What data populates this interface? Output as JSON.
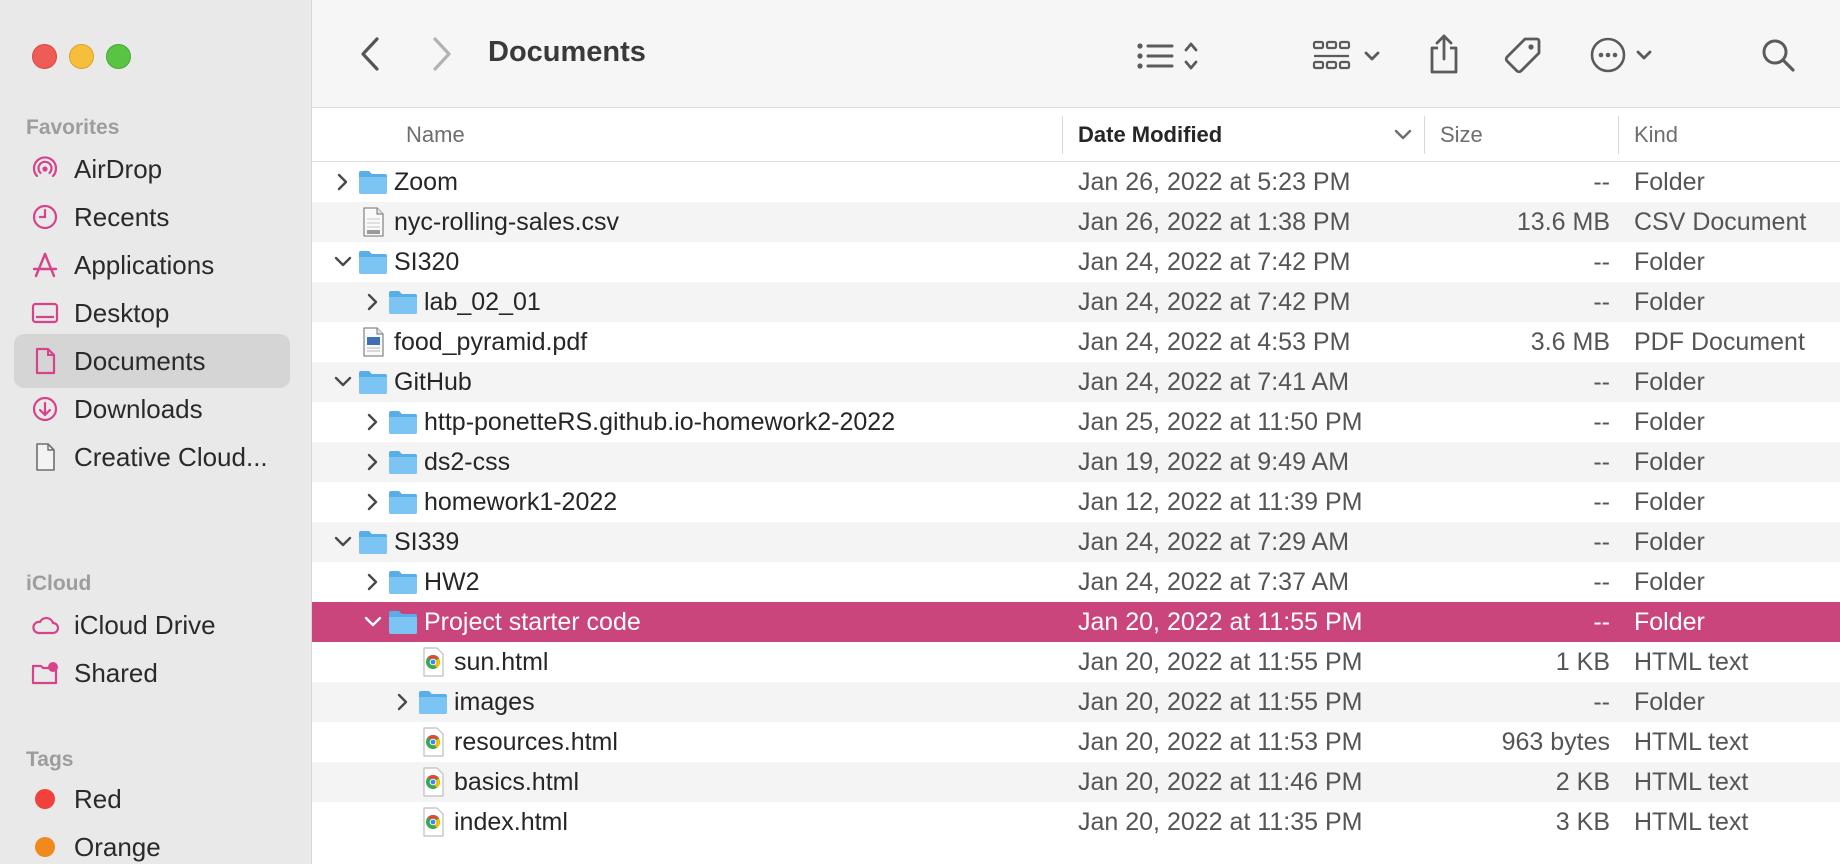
{
  "window": {
    "title": "Documents"
  },
  "colors": {
    "accent": "#c9457c",
    "folder": "#6cb9ee",
    "sidebar_icon": "#d6438a"
  },
  "sidebar": {
    "favorites_label": "Favorites",
    "favorites": [
      {
        "label": "AirDrop",
        "icon": "airdrop-icon"
      },
      {
        "label": "Recents",
        "icon": "clock-icon"
      },
      {
        "label": "Applications",
        "icon": "applications-icon"
      },
      {
        "label": "Desktop",
        "icon": "desktop-icon"
      },
      {
        "label": "Documents",
        "icon": "document-icon",
        "selected": true
      },
      {
        "label": "Downloads",
        "icon": "download-icon"
      },
      {
        "label": "Creative Cloud...",
        "icon": "file-icon"
      }
    ],
    "icloud_label": "iCloud",
    "icloud": [
      {
        "label": "iCloud Drive",
        "icon": "cloud-icon"
      },
      {
        "label": "Shared",
        "icon": "shared-folder-icon"
      }
    ],
    "tags_label": "Tags",
    "tags": [
      {
        "label": "Red",
        "color": "#f0423a"
      },
      {
        "label": "Orange",
        "color": "#f08a1c"
      }
    ]
  },
  "columns": {
    "name": "Name",
    "date": "Date Modified",
    "size": "Size",
    "kind": "Kind"
  },
  "files": [
    {
      "name": "Zoom",
      "date": "Jan 26, 2022 at 5:23 PM",
      "size": "--",
      "kind": "Folder",
      "type": "folder",
      "level": 0,
      "disclosure": "collapsed"
    },
    {
      "name": "nyc-rolling-sales.csv",
      "date": "Jan 26, 2022 at 1:38 PM",
      "size": "13.6 MB",
      "kind": "CSV Document",
      "type": "csv",
      "level": 0,
      "disclosure": "none"
    },
    {
      "name": "SI320",
      "date": "Jan 24, 2022 at 7:42 PM",
      "size": "--",
      "kind": "Folder",
      "type": "folder",
      "level": 0,
      "disclosure": "expanded"
    },
    {
      "name": "lab_02_01",
      "date": "Jan 24, 2022 at 7:42 PM",
      "size": "--",
      "kind": "Folder",
      "type": "folder",
      "level": 1,
      "disclosure": "collapsed"
    },
    {
      "name": "food_pyramid.pdf",
      "date": "Jan 24, 2022 at 4:53 PM",
      "size": "3.6 MB",
      "kind": "PDF Document",
      "type": "pdf",
      "level": 0,
      "disclosure": "none"
    },
    {
      "name": "GitHub",
      "date": "Jan 24, 2022 at 7:41 AM",
      "size": "--",
      "kind": "Folder",
      "type": "folder",
      "level": 0,
      "disclosure": "expanded"
    },
    {
      "name": "http-ponetteRS.github.io-homework2-2022",
      "date": "Jan 25, 2022 at 11:50 PM",
      "size": "--",
      "kind": "Folder",
      "type": "folder",
      "level": 1,
      "disclosure": "collapsed"
    },
    {
      "name": "ds2-css",
      "date": "Jan 19, 2022 at 9:49 AM",
      "size": "--",
      "kind": "Folder",
      "type": "folder",
      "level": 1,
      "disclosure": "collapsed"
    },
    {
      "name": "homework1-2022",
      "date": "Jan 12, 2022 at 11:39 PM",
      "size": "--",
      "kind": "Folder",
      "type": "folder",
      "level": 1,
      "disclosure": "collapsed"
    },
    {
      "name": "SI339",
      "date": "Jan 24, 2022 at 7:29 AM",
      "size": "--",
      "kind": "Folder",
      "type": "folder",
      "level": 0,
      "disclosure": "expanded"
    },
    {
      "name": "HW2",
      "date": "Jan 24, 2022 at 7:37 AM",
      "size": "--",
      "kind": "Folder",
      "type": "folder",
      "level": 1,
      "disclosure": "collapsed"
    },
    {
      "name": "Project starter code",
      "date": "Jan 20, 2022 at 11:55 PM",
      "size": "--",
      "kind": "Folder",
      "type": "folder",
      "level": 1,
      "disclosure": "expanded",
      "selected": true
    },
    {
      "name": "sun.html",
      "date": "Jan 20, 2022 at 11:55 PM",
      "size": "1 KB",
      "kind": "HTML text",
      "type": "html",
      "level": 2,
      "disclosure": "none"
    },
    {
      "name": "images",
      "date": "Jan 20, 2022 at 11:55 PM",
      "size": "--",
      "kind": "Folder",
      "type": "folder",
      "level": 2,
      "disclosure": "collapsed"
    },
    {
      "name": "resources.html",
      "date": "Jan 20, 2022 at 11:53 PM",
      "size": "963 bytes",
      "kind": "HTML text",
      "type": "html",
      "level": 2,
      "disclosure": "none"
    },
    {
      "name": "basics.html",
      "date": "Jan 20, 2022 at 11:46 PM",
      "size": "2 KB",
      "kind": "HTML text",
      "type": "html",
      "level": 2,
      "disclosure": "none"
    },
    {
      "name": "index.html",
      "date": "Jan 20, 2022 at 11:35 PM",
      "size": "3 KB",
      "kind": "HTML text",
      "type": "html",
      "level": 2,
      "disclosure": "none"
    }
  ]
}
